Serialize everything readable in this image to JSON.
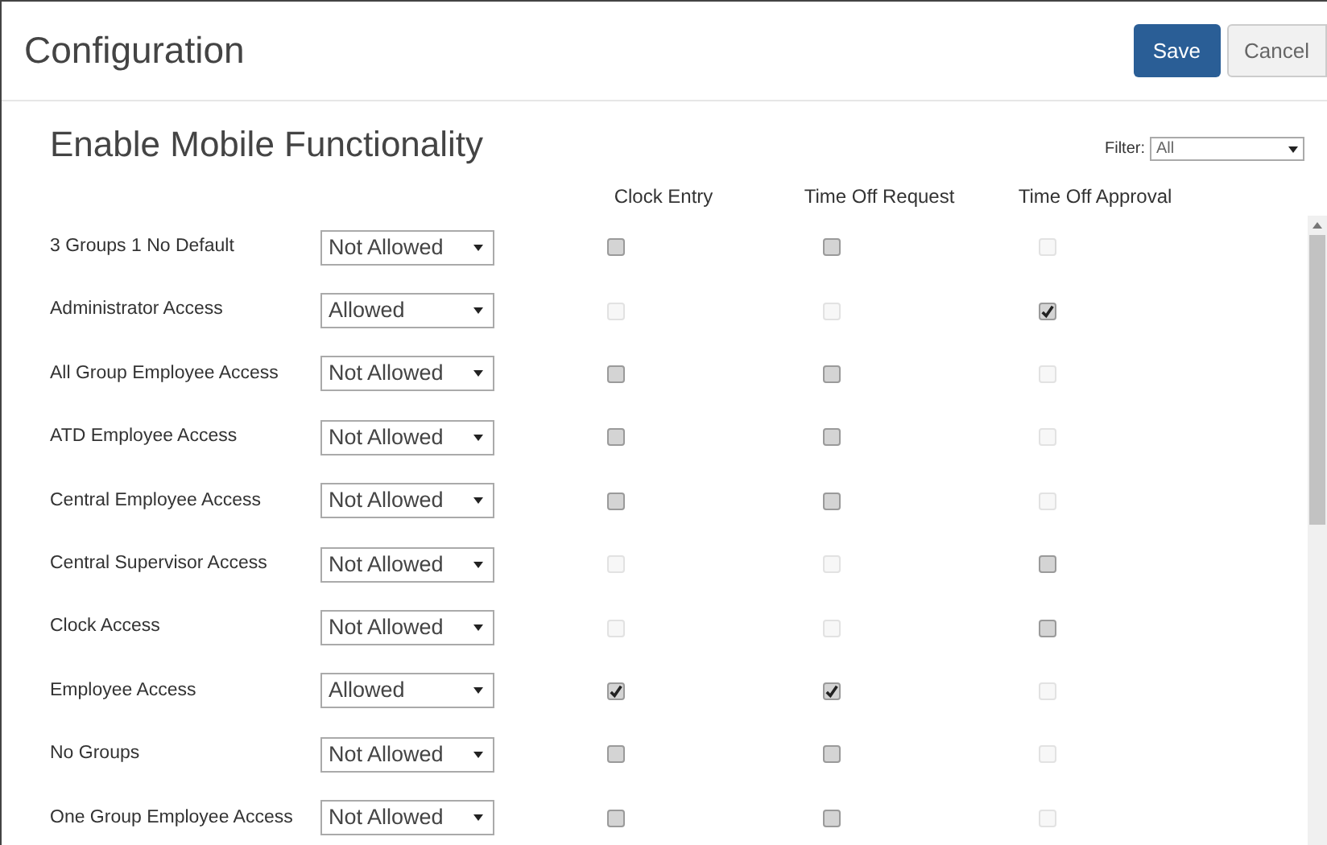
{
  "header": {
    "title": "Configuration",
    "buttons": [
      {
        "label": "Save",
        "kind": "primary"
      },
      {
        "label": "Cancel",
        "kind": "secondary"
      }
    ]
  },
  "section": {
    "title": "Enable Mobile Functionality",
    "filter": {
      "label": "Filter:",
      "value": "All"
    }
  },
  "columns": [
    "Clock Entry",
    "Time Off Request",
    "Time Off Approval"
  ],
  "rows": [
    {
      "name": "3 Groups 1 No Default",
      "access": "Not Allowed",
      "cells": [
        {
          "checked": false,
          "disabled": false
        },
        {
          "checked": false,
          "disabled": false
        },
        {
          "checked": false,
          "disabled": true
        }
      ]
    },
    {
      "name": "Administrator Access",
      "access": "Allowed",
      "cells": [
        {
          "checked": false,
          "disabled": true
        },
        {
          "checked": false,
          "disabled": true
        },
        {
          "checked": true,
          "disabled": false
        }
      ]
    },
    {
      "name": "All Group Employee Access",
      "access": "Not Allowed",
      "cells": [
        {
          "checked": false,
          "disabled": false
        },
        {
          "checked": false,
          "disabled": false
        },
        {
          "checked": false,
          "disabled": true
        }
      ]
    },
    {
      "name": "ATD Employee Access",
      "access": "Not Allowed",
      "cells": [
        {
          "checked": false,
          "disabled": false
        },
        {
          "checked": false,
          "disabled": false
        },
        {
          "checked": false,
          "disabled": true
        }
      ]
    },
    {
      "name": "Central Employee Access",
      "access": "Not Allowed",
      "cells": [
        {
          "checked": false,
          "disabled": false
        },
        {
          "checked": false,
          "disabled": false
        },
        {
          "checked": false,
          "disabled": true
        }
      ]
    },
    {
      "name": "Central Supervisor Access",
      "access": "Not Allowed",
      "cells": [
        {
          "checked": false,
          "disabled": true
        },
        {
          "checked": false,
          "disabled": true
        },
        {
          "checked": false,
          "disabled": false
        }
      ]
    },
    {
      "name": "Clock Access",
      "access": "Not Allowed",
      "cells": [
        {
          "checked": false,
          "disabled": true
        },
        {
          "checked": false,
          "disabled": true
        },
        {
          "checked": false,
          "disabled": false
        }
      ]
    },
    {
      "name": "Employee Access",
      "access": "Allowed",
      "cells": [
        {
          "checked": true,
          "disabled": false
        },
        {
          "checked": true,
          "disabled": false
        },
        {
          "checked": false,
          "disabled": true
        }
      ]
    },
    {
      "name": "No Groups",
      "access": "Not Allowed",
      "cells": [
        {
          "checked": false,
          "disabled": false
        },
        {
          "checked": false,
          "disabled": false
        },
        {
          "checked": false,
          "disabled": true
        }
      ]
    },
    {
      "name": "One Group Employee Access",
      "access": "Not Allowed",
      "cells": [
        {
          "checked": false,
          "disabled": false
        },
        {
          "checked": false,
          "disabled": false
        },
        {
          "checked": false,
          "disabled": true
        }
      ]
    }
  ]
}
